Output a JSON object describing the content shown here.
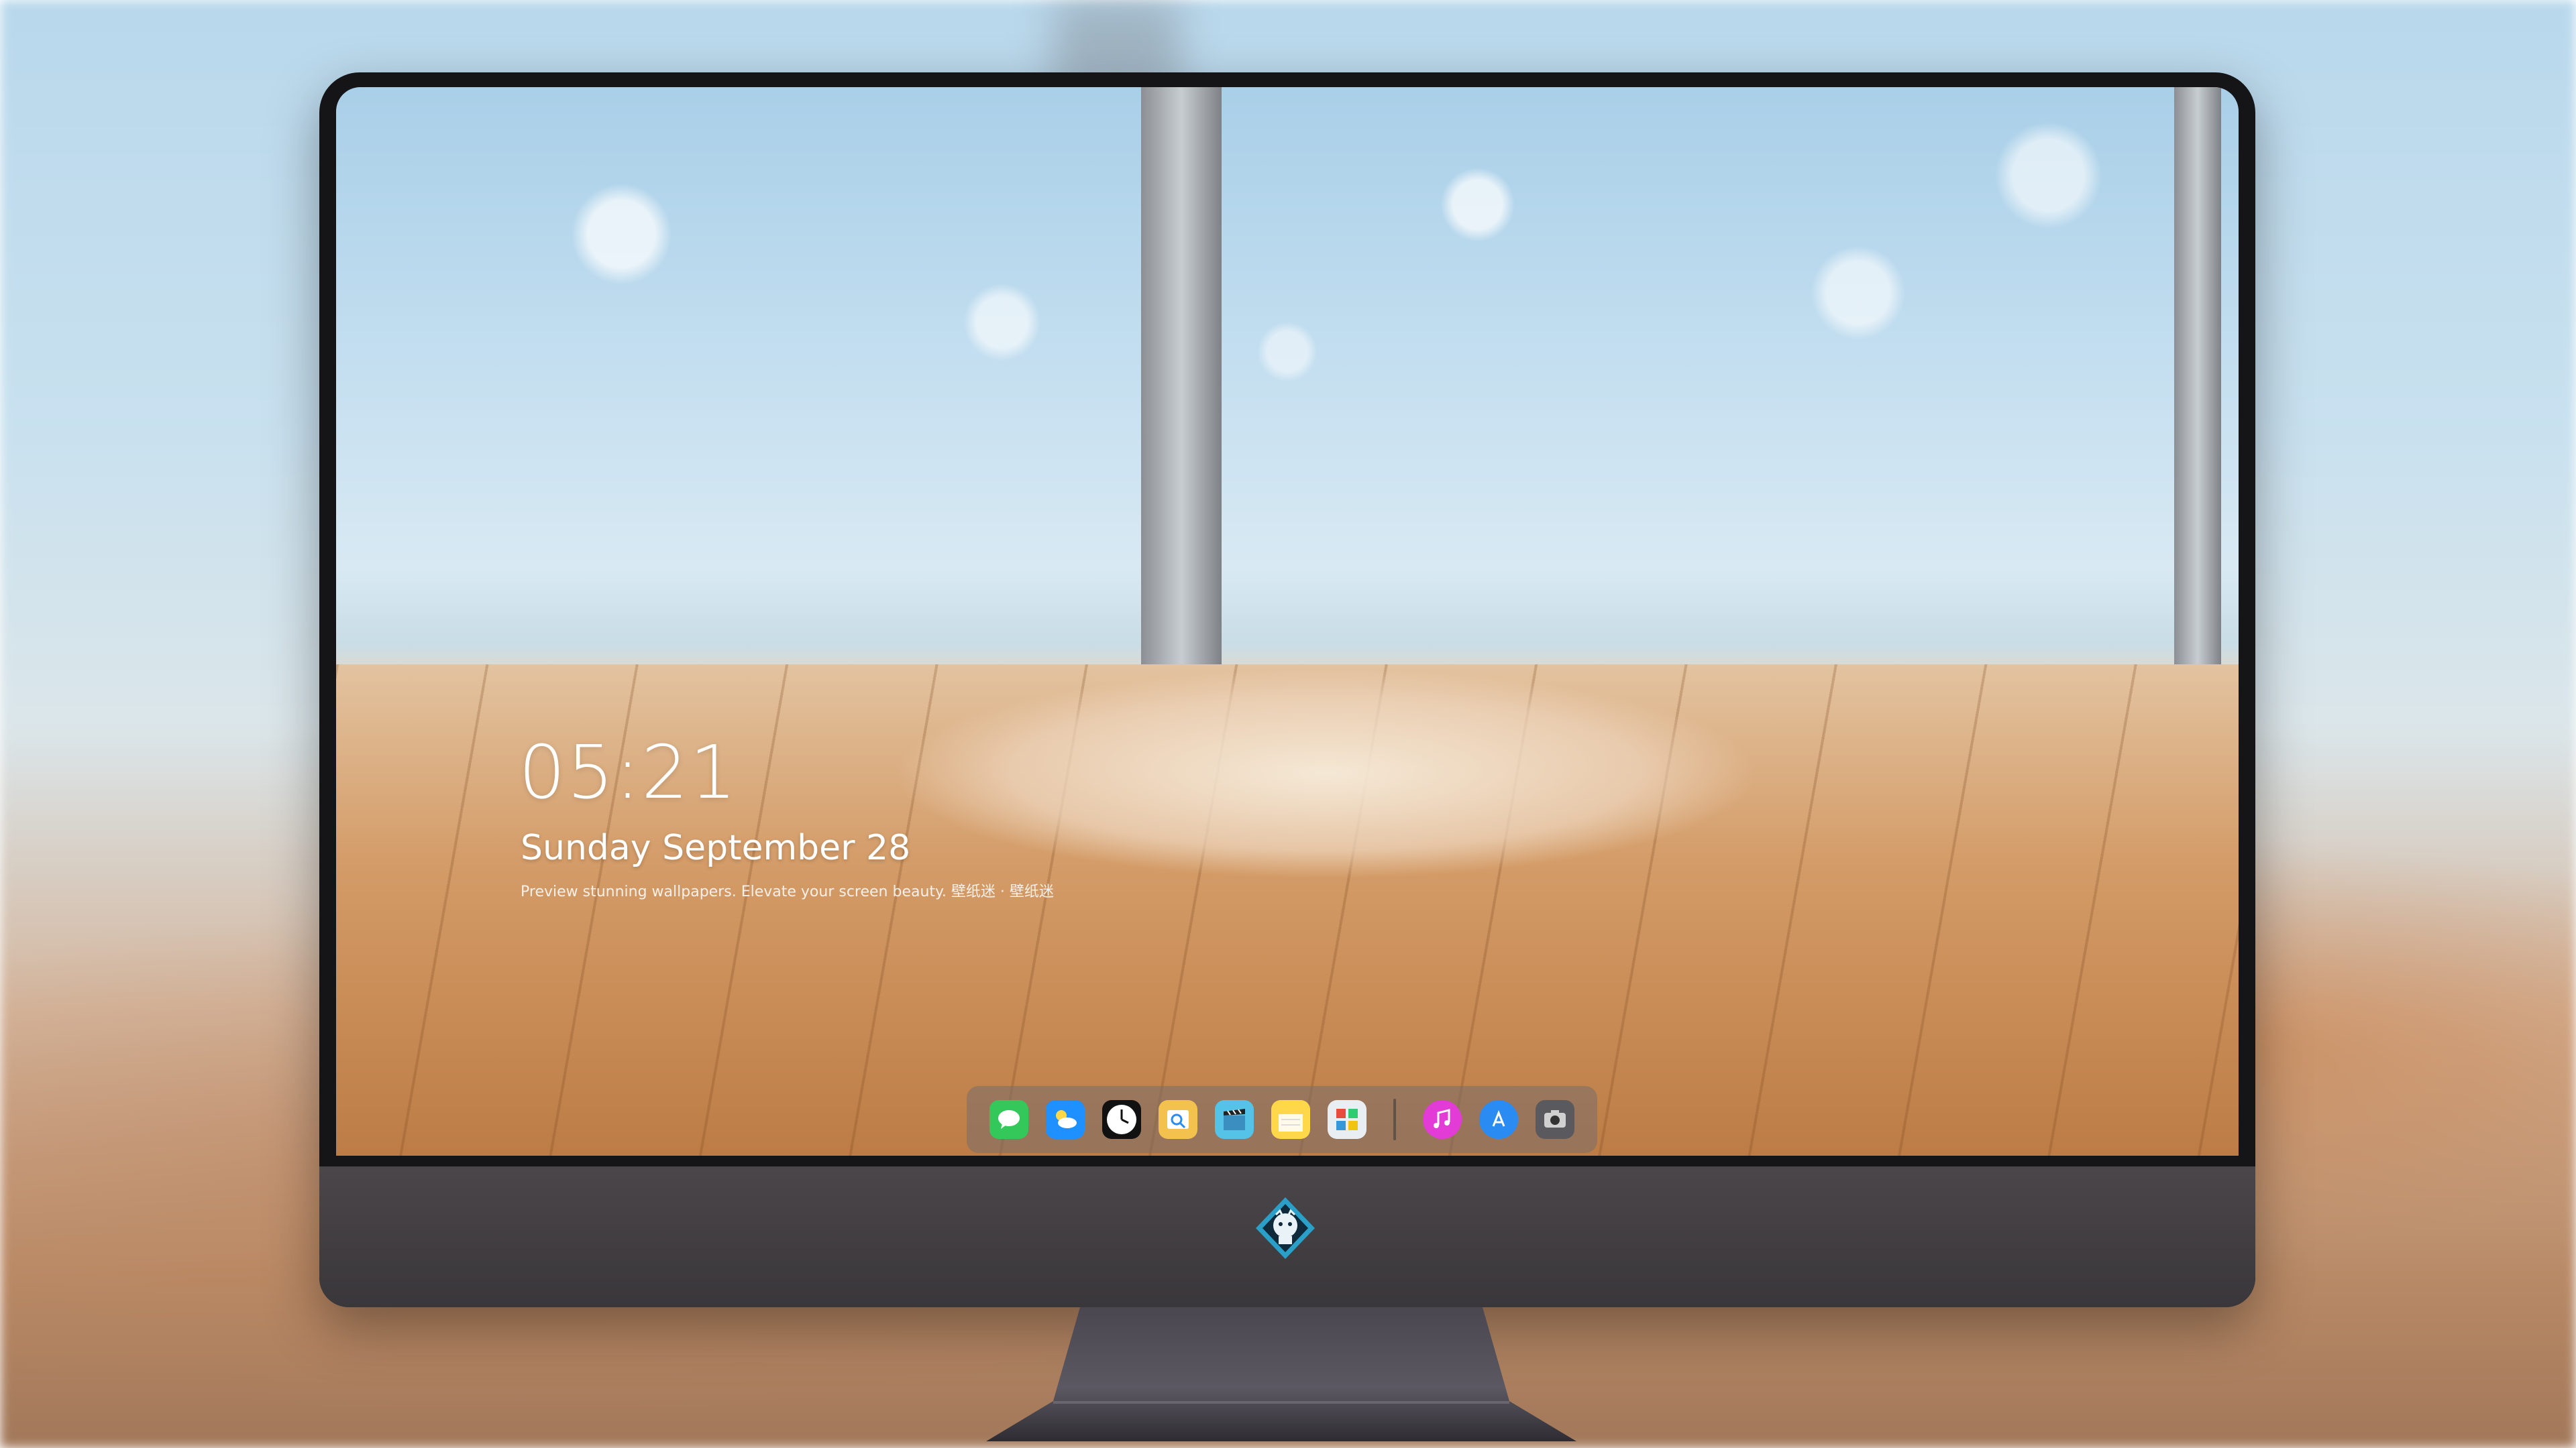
{
  "lockscreen": {
    "time": "05:21",
    "date": "Sunday September  28",
    "tagline": "Preview stunning wallpapers. Elevate your screen beauty. 壁纸迷 · 壁纸迷"
  },
  "dock": {
    "items": [
      {
        "name": "Messages",
        "icon": "messages-icon",
        "color": "#34c759"
      },
      {
        "name": "Weather",
        "icon": "weather-icon",
        "color": "#1e90ff"
      },
      {
        "name": "Clock",
        "icon": "clock-icon",
        "color": "#111111"
      },
      {
        "name": "Preview",
        "icon": "preview-icon",
        "color": "#f2c14e"
      },
      {
        "name": "Video",
        "icon": "clapperboard-icon",
        "color": "#55c2e8"
      },
      {
        "name": "Notes",
        "icon": "notes-icon",
        "color": "#ffd84a"
      },
      {
        "name": "Photos",
        "icon": "photos-icon",
        "color": "#e9eef2"
      },
      {
        "name": "Music",
        "icon": "music-icon",
        "color": "#e23bd6"
      },
      {
        "name": "App Store",
        "icon": "app-store-icon",
        "color": "#2a8bf2"
      },
      {
        "name": "Camera",
        "icon": "camera-icon",
        "color": "#5a5a5e"
      }
    ]
  },
  "colors": {
    "bezel": "#151517",
    "chin": "#3f3c40",
    "accent": "#34c759"
  }
}
